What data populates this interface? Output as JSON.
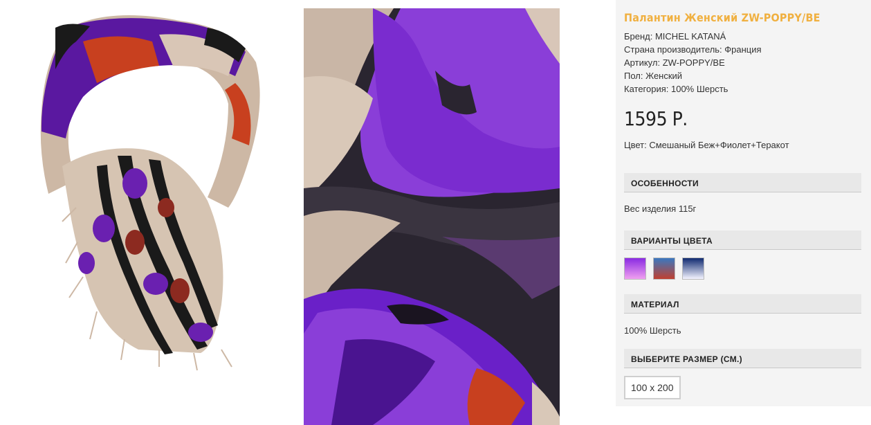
{
  "product": {
    "title": "Палантин Женский ZW-POPPY/BE",
    "specs": [
      "Бренд: MICHEL KATANÁ",
      "Страна производитель: Франция",
      "Артикул: ZW-POPPY/BE",
      "Пол: Женский",
      "Категория: 100% Шерсть"
    ],
    "price": "1595 Р.",
    "color": "Цвет: Смешаный Беж+Фиолет+Теракот"
  },
  "sections": {
    "features_title": "ОСОБЕННОСТИ",
    "features_text": "Вес изделия 115г",
    "colors_title": "ВАРИАНТЫ ЦВЕТА",
    "material_title": "МАТЕРИАЛ",
    "material_text": "100% Шерсть",
    "size_title": "ВЫБЕРИТЕ РАЗМЕР (СМ.)",
    "size_option": "100 х 200"
  },
  "swatches": [
    {
      "name": "purple",
      "top": "#8a2be2",
      "bottom": "#f0a0f0"
    },
    {
      "name": "blue-red",
      "top": "#3a78c0",
      "bottom": "#c04030"
    },
    {
      "name": "navy-white",
      "top": "#102a70",
      "bottom": "#f4f4ff"
    }
  ],
  "colors": {
    "title": "#f0b040",
    "panel": "#f4f4f4",
    "header": "#e8e8e8"
  }
}
